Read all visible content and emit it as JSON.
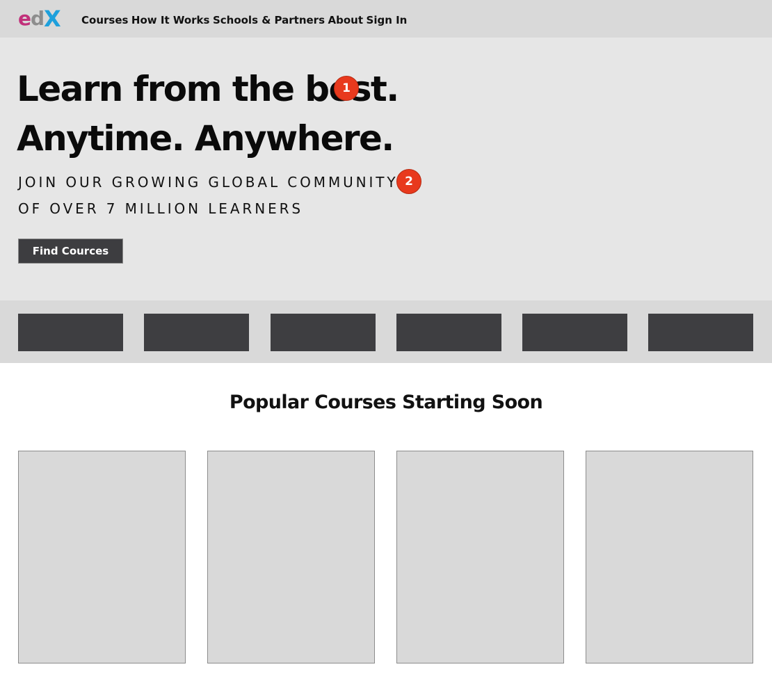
{
  "brand": {
    "logo_letters": [
      "e",
      "d",
      "X"
    ],
    "logo_colors": [
      "#c1307a",
      "#8d8d8d",
      "#1ea0dc"
    ]
  },
  "nav": {
    "items": [
      "Courses",
      "How It Works",
      "Schools & Partners",
      "About",
      "Sign In"
    ]
  },
  "hero": {
    "headline_line1": "Learn from the best.",
    "headline_line2": "Anytime. Anywhere.",
    "sub_line1": "JOIN OUR GROWING GLOBAL COMMUNITY",
    "sub_line2": "OF OVER 7 MILLION LEARNERS",
    "cta_label": "Find Cources",
    "badges": [
      "1",
      "2"
    ],
    "badge_color": "#e8391d"
  },
  "partners": {
    "logo_count": 6
  },
  "popular": {
    "title": "Popular Courses Starting Soon",
    "card_count": 4
  }
}
